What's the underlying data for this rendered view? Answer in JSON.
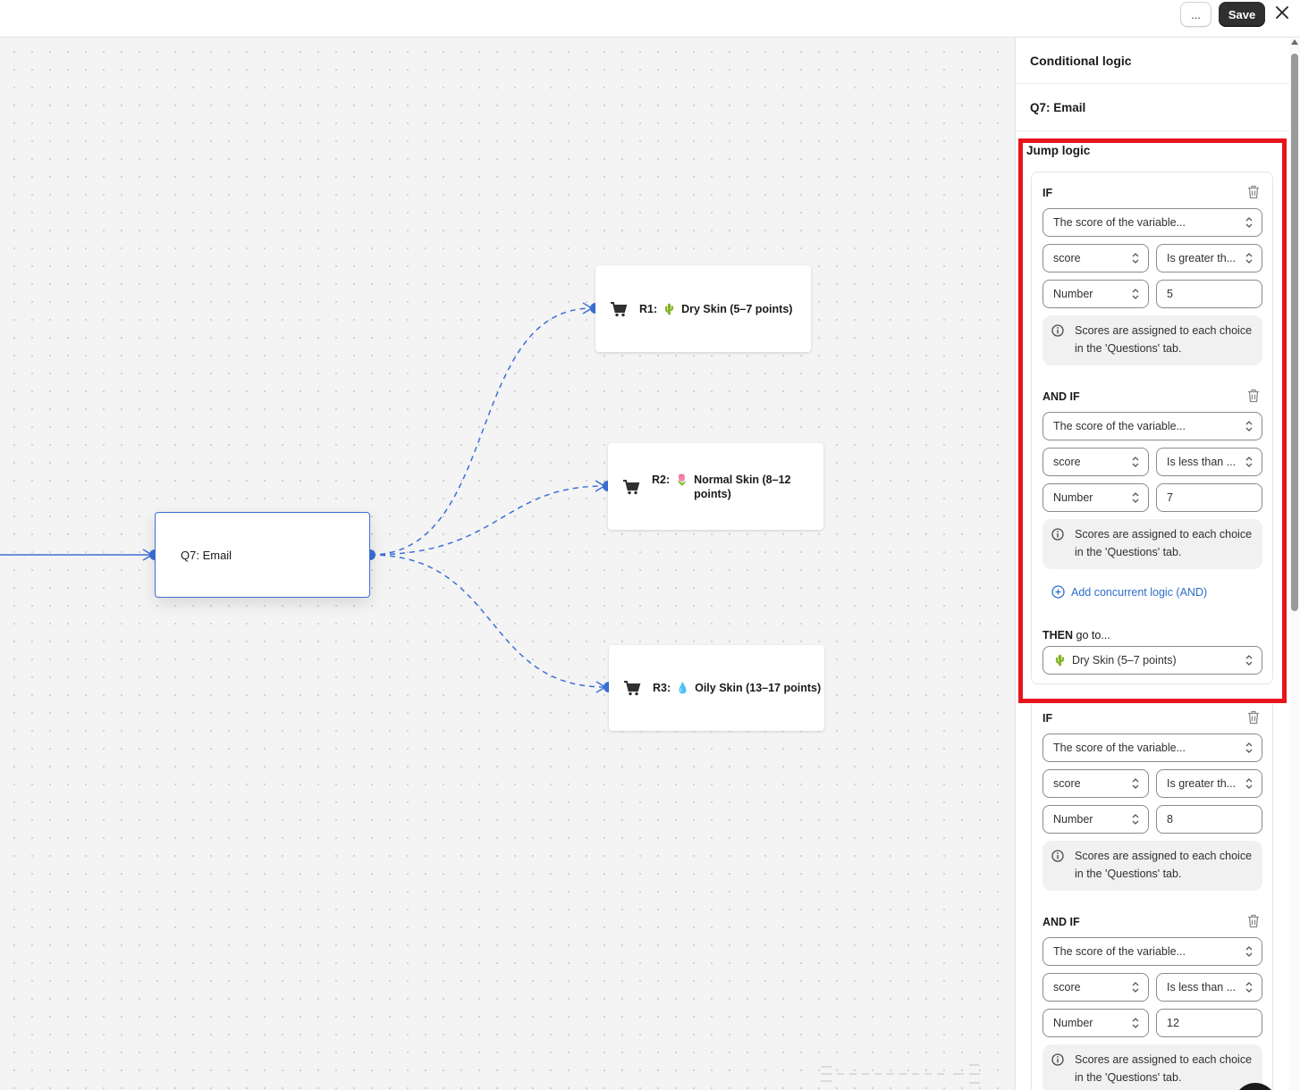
{
  "topbar": {
    "more_label": "...",
    "save_label": "Save"
  },
  "canvas": {
    "q7_node": {
      "label": "Q7: Email"
    },
    "results": [
      {
        "prefix": "R1:",
        "emoji": "🌵",
        "label": "Dry Skin (5–7 points)"
      },
      {
        "prefix": "R2:",
        "emoji": "🌷",
        "label": "Normal Skin (8–12 points)"
      },
      {
        "prefix": "R3:",
        "emoji": "💧",
        "label": "Oily Skin (13–17 points)"
      }
    ]
  },
  "panel": {
    "title": "Conditional logic",
    "question": "Q7: Email",
    "jump_logic_title": "Jump logic",
    "rules": [
      {
        "if_label": "IF",
        "if_source": "The score of the variable...",
        "if_variable": "score",
        "if_operator": "Is greater th...",
        "if_type": "Number",
        "if_value": "5",
        "if_note": "Scores are assigned to each choice in the 'Questions' tab.",
        "and_label": "AND IF",
        "and_source": "The score of the variable...",
        "and_variable": "score",
        "and_operator": "Is less than ...",
        "and_type": "Number",
        "and_value": "7",
        "and_note": "Scores are assigned to each choice in the 'Questions' tab.",
        "add_and_label": "Add concurrent logic (AND)",
        "then_bold": "THEN",
        "then_rest": "go to...",
        "then_emoji": "🌵",
        "then_target": "Dry Skin (5–7 points)"
      },
      {
        "if_label": "IF",
        "if_source": "The score of the variable...",
        "if_variable": "score",
        "if_operator": "Is greater th...",
        "if_type": "Number",
        "if_value": "8",
        "if_note": "Scores are assigned to each choice in the 'Questions' tab.",
        "and_label": "AND IF",
        "and_source": "The score of the variable...",
        "and_variable": "score",
        "and_operator": "Is less than ...",
        "and_type": "Number",
        "and_value": "12",
        "and_note": "Scores are assigned to each choice in the 'Questions' tab."
      }
    ]
  },
  "colors": {
    "accent_blue": "#3b6fd6",
    "link_blue": "#2c6ecb",
    "highlight_red": "#e8141c",
    "save_bg": "#303030"
  },
  "icons": [
    "close-icon",
    "cart-icon",
    "trash-icon",
    "chevron-updown-icon",
    "info-icon",
    "plus-circle-icon"
  ]
}
